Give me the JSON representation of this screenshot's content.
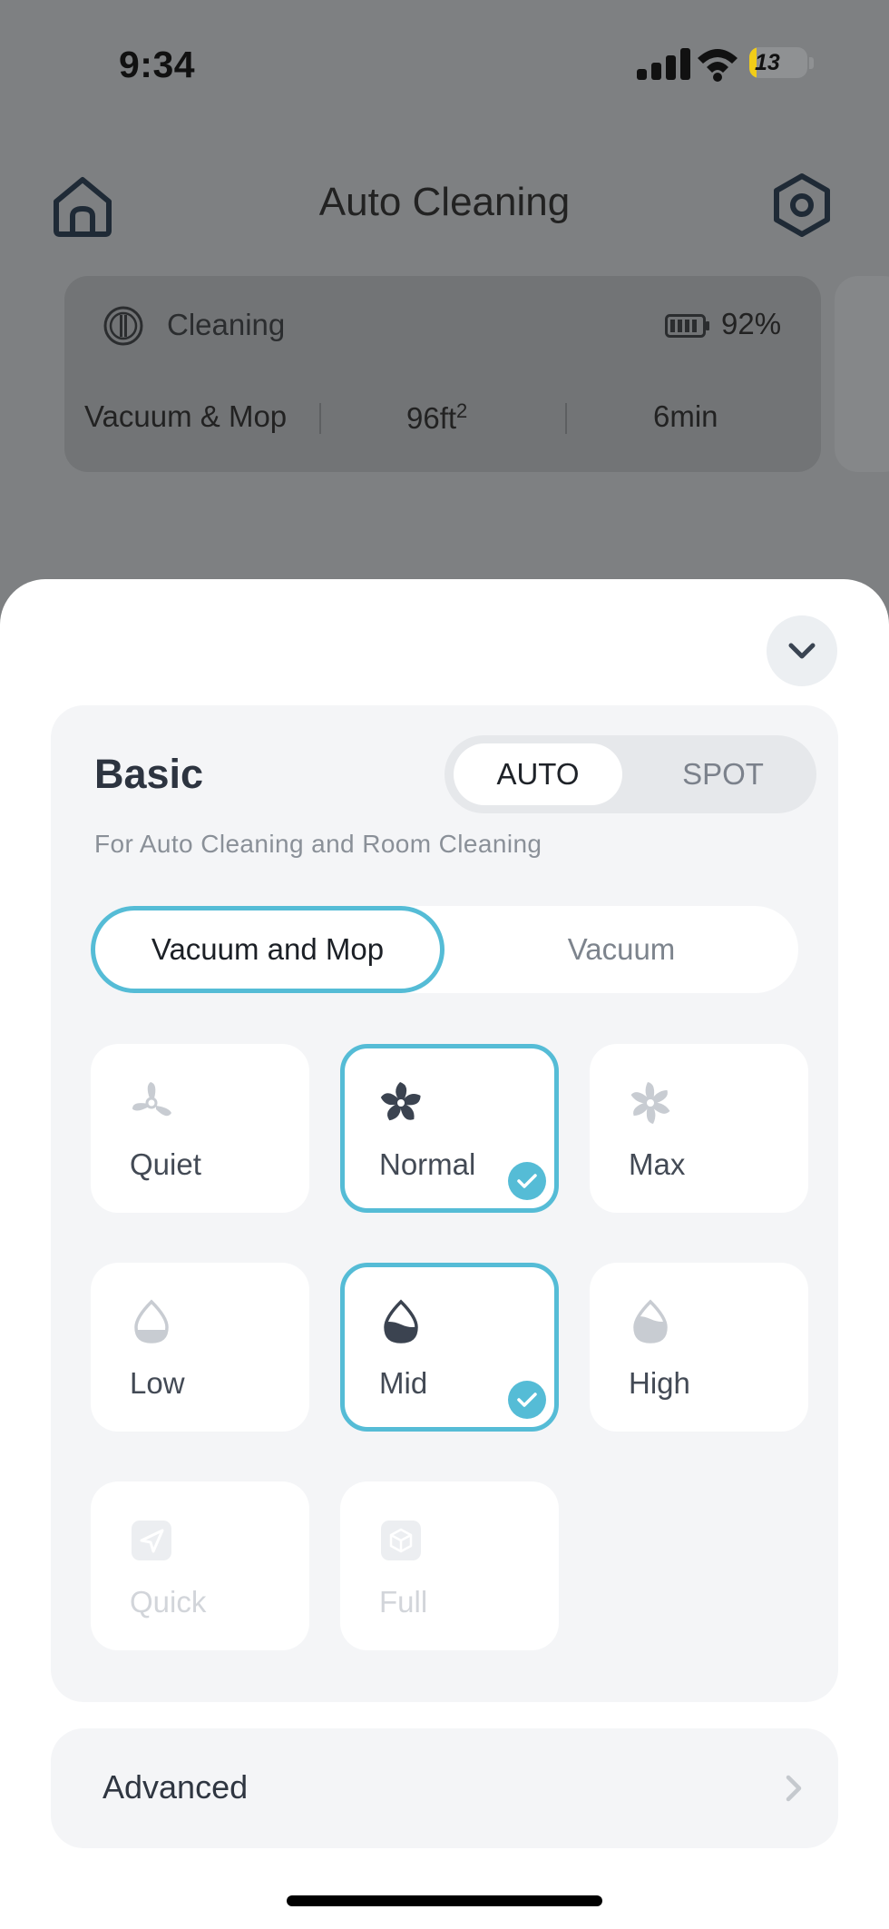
{
  "status_bar": {
    "time": "9:34",
    "battery": "13",
    "battery_level": 0.13
  },
  "header": {
    "title": "Auto Cleaning",
    "home_icon": "home-icon",
    "settings_icon": "settings-icon"
  },
  "status_card": {
    "state": "Cleaning",
    "battery_pct": "92%",
    "mode": "Vacuum & Mop",
    "area_value": "96ft",
    "area_exp": "2",
    "duration": "6min"
  },
  "sheet": {
    "collapse_icon": "chevron-down-icon",
    "basic": {
      "title": "Basic",
      "segments": [
        "AUTO",
        "SPOT"
      ],
      "selected_segment": "AUTO",
      "subtitle": "For Auto Cleaning and Room Cleaning",
      "modes": [
        "Vacuum and Mop",
        "Vacuum"
      ],
      "selected_mode": "Vacuum and Mop",
      "suction": [
        {
          "label": "Quiet",
          "icon": "fan-icon",
          "selected": false
        },
        {
          "label": "Normal",
          "icon": "fan-icon",
          "selected": true
        },
        {
          "label": "Max",
          "icon": "fan-icon",
          "selected": false
        }
      ],
      "water": [
        {
          "label": "Low",
          "icon": "water-drop-icon",
          "selected": false
        },
        {
          "label": "Mid",
          "icon": "water-drop-icon",
          "selected": true
        },
        {
          "label": "High",
          "icon": "water-drop-icon",
          "selected": false
        }
      ],
      "route": [
        {
          "label": "Quick",
          "icon": "send-icon",
          "disabled": true
        },
        {
          "label": "Full",
          "icon": "box-icon",
          "disabled": true
        }
      ]
    },
    "advanced": {
      "label": "Advanced"
    }
  },
  "colors": {
    "accent": "#55bcd6",
    "panel": "#f4f5f7",
    "overlay": "#7e8082"
  }
}
